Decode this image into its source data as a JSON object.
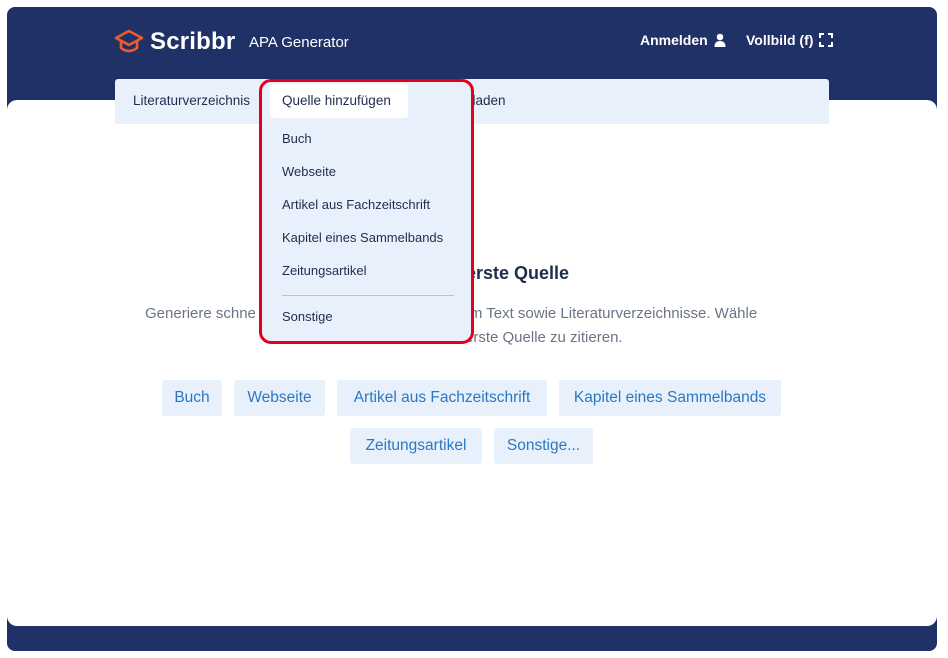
{
  "header": {
    "logo_text": "Scribbr",
    "app_title": "APA Generator",
    "login_label": "Anmelden",
    "fullscreen_label": "Vollbild (f)"
  },
  "tabs": {
    "list": "Literaturverzeichnis",
    "add_source": "Quelle hinzufügen",
    "download": "Herunterladen"
  },
  "dropdown": {
    "items": [
      "Buch",
      "Webseite",
      "Artikel aus Fachzeitschrift",
      "Kapitel eines Sammelbands",
      "Zeitungsartikel"
    ],
    "other": "Sonstige"
  },
  "main": {
    "headline": "erste Quelle",
    "description_line1_left": "Generiere schne",
    "description_line1_right": "n im Text sowie Literaturverzeichnisse. Wähle",
    "description_line2_right": "erste Quelle zu zitieren.",
    "source_buttons_row1": [
      "Buch",
      "Webseite",
      "Artikel aus Fachzeitschrift",
      "Kapitel eines Sammelbands"
    ],
    "source_buttons_row2": [
      "Zeitungsartikel",
      "Sonstige..."
    ]
  },
  "colors": {
    "brand_navy": "#1f3166",
    "logo_orange": "#f05a28",
    "light_blue": "#e8f1fb",
    "link_blue": "#2a78c4",
    "highlight_red": "#e3001b"
  }
}
